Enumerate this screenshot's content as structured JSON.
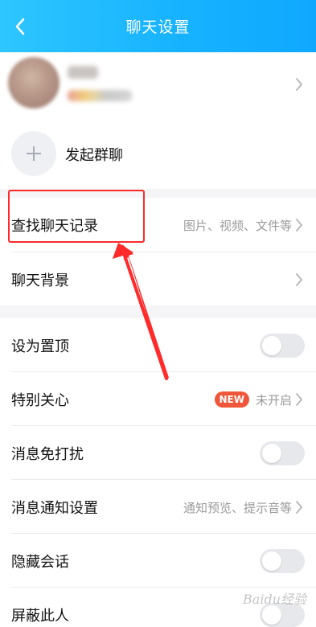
{
  "header": {
    "title": "聊天设置",
    "background_color": "#17b3ff"
  },
  "profile": {
    "add_group_label": "发起群聊"
  },
  "rows": {
    "chat_history": {
      "label": "查找聊天记录",
      "hint": "图片、视频、文件等"
    },
    "chat_background": {
      "label": "聊天背景"
    },
    "pin_top": {
      "label": "设为置顶",
      "toggle_on": false
    },
    "special_care": {
      "label": "特别关心",
      "badge": "NEW",
      "hint": "未开启"
    },
    "do_not_disturb": {
      "label": "消息免打扰",
      "toggle_on": false
    },
    "notification_settings": {
      "label": "消息通知设置",
      "hint": "通知预览、提示音等"
    },
    "hide_chat": {
      "label": "隐藏会话",
      "toggle_on": false
    },
    "block_person": {
      "label": "屏蔽此人",
      "toggle_on": false
    }
  },
  "annotation": {
    "highlight_color": "#ff2a2a"
  },
  "icons": {
    "back": "back-arrow-icon",
    "chevron": "chevron-right-icon",
    "plus": "plus-icon"
  },
  "watermark": "Baidu经验"
}
